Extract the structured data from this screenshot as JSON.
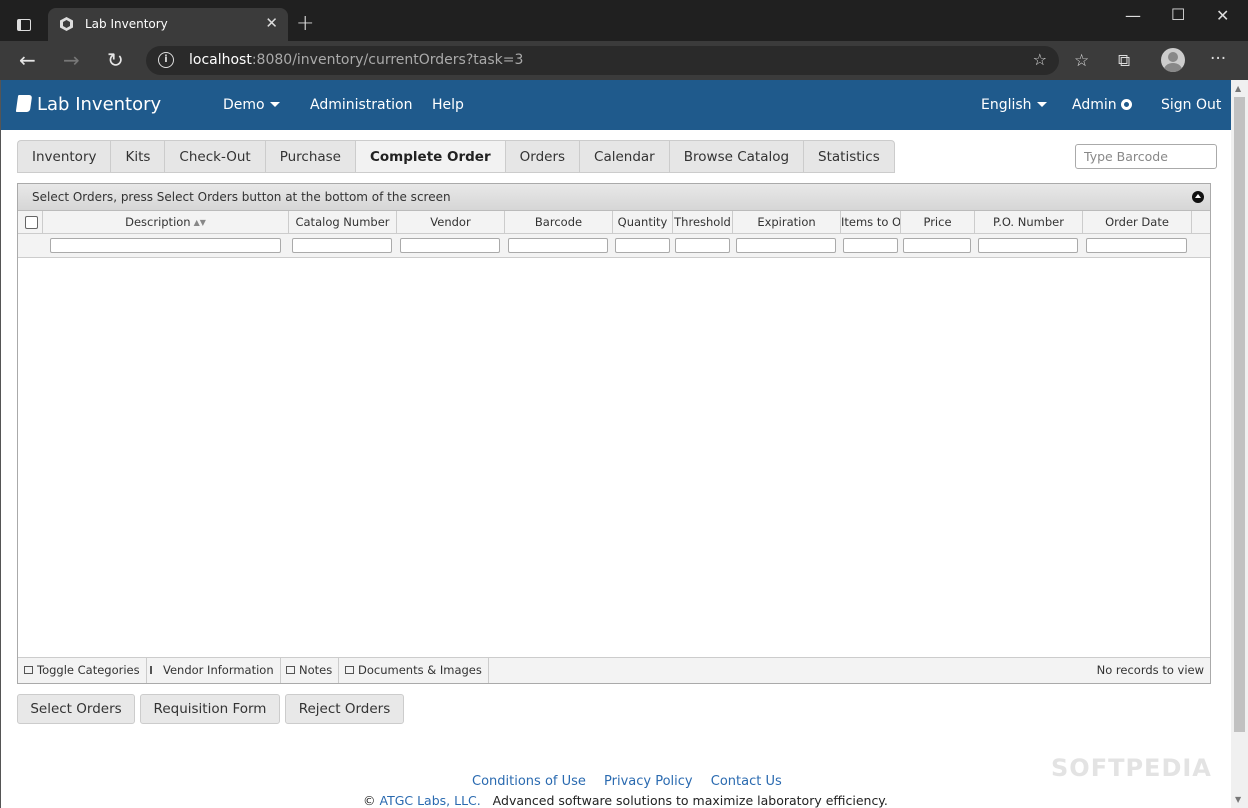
{
  "browser": {
    "tab_title": "Lab Inventory",
    "url_host": "localhost",
    "url_rest": ":8080/inventory/currentOrders?task=3"
  },
  "navbar": {
    "brand": "Lab Inventory",
    "items": [
      "Demo",
      "Administration",
      "Help"
    ],
    "language": "English",
    "admin": "Admin",
    "sign_out": "Sign Out"
  },
  "tabs": [
    "Inventory",
    "Kits",
    "Check-Out",
    "Purchase",
    "Complete Order",
    "Orders",
    "Calendar",
    "Browse Catalog",
    "Statistics"
  ],
  "active_tab": "Complete Order",
  "barcode": {
    "placeholder": "Type Barcode"
  },
  "grid": {
    "caption": "Select Orders, press Select Orders button at the bottom of the screen",
    "columns": [
      "Description",
      "Catalog Number",
      "Vendor",
      "Barcode",
      "Quantity",
      "Threshold",
      "Expiration",
      "Items to Order",
      "Price",
      "P.O. Number",
      "Order Date"
    ],
    "rows": [],
    "pager": {
      "buttons": [
        "Toggle Categories",
        "Vendor Information",
        "Notes",
        "Documents & Images"
      ],
      "records": "No records to view"
    }
  },
  "actions": [
    "Select Orders",
    "Requisition Form",
    "Reject Orders"
  ],
  "footer": {
    "links": [
      "Conditions of Use",
      "Privacy Policy",
      "Contact Us"
    ],
    "copyright_symbol": "©",
    "company": "ATGC Labs, LLC.",
    "tagline": "Advanced software solutions to maximize laboratory efficiency."
  },
  "watermark": "SOFTPEDIA"
}
